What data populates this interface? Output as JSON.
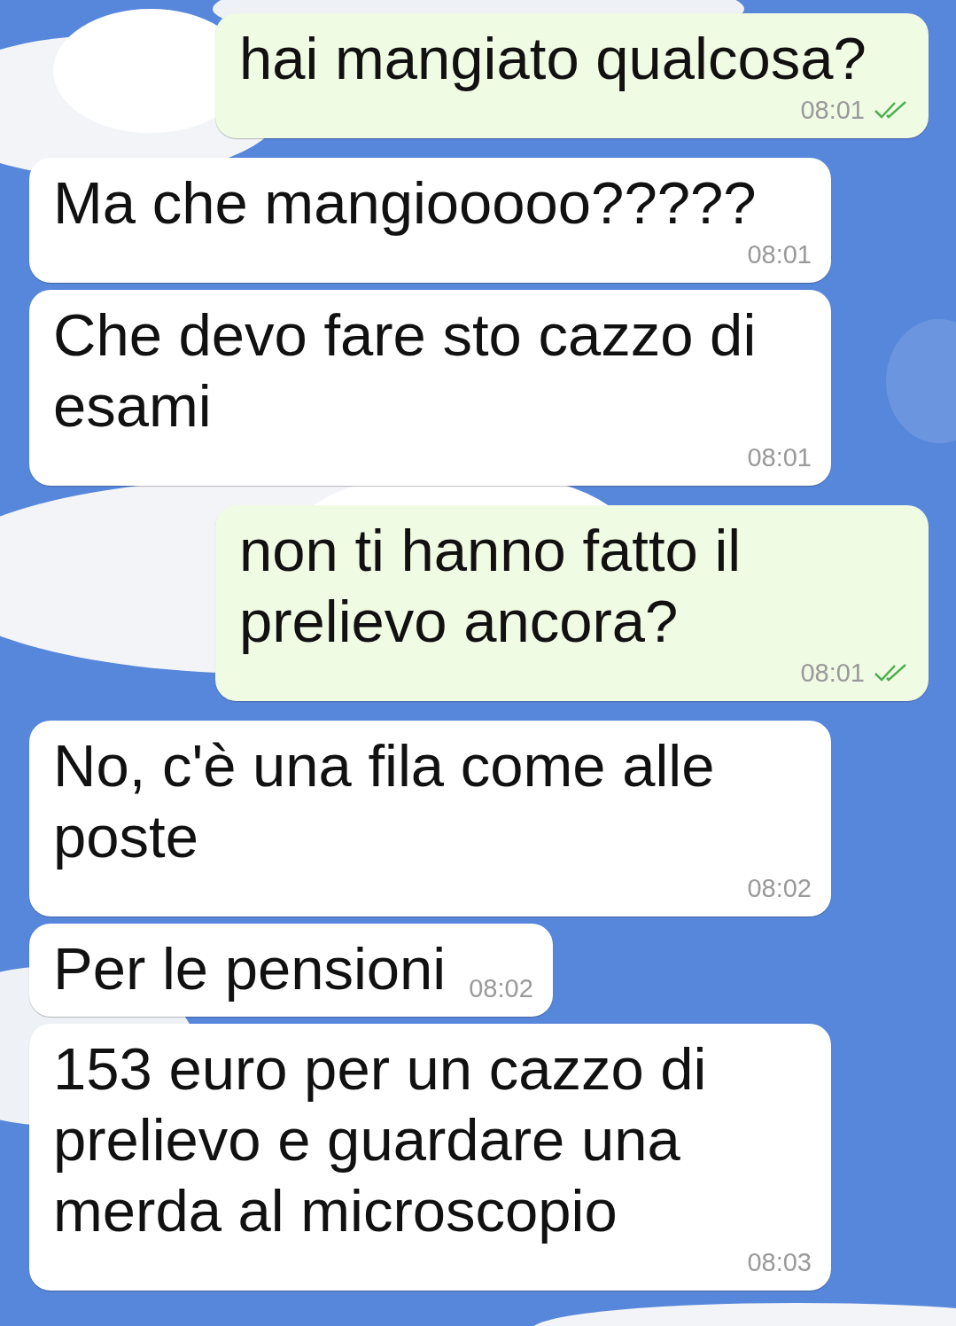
{
  "messages": [
    {
      "kind": "sent",
      "text": "hai mangiato qualcosa?",
      "time": "08:01",
      "read": true
    },
    {
      "kind": "received",
      "text": "Ma che mangiooooo?????",
      "time": "08:01"
    },
    {
      "kind": "received",
      "text": "Che devo fare sto cazzo di esami",
      "time": "08:01"
    },
    {
      "kind": "sent",
      "text": "non ti hanno fatto il prelievo ancora?",
      "time": "08:01",
      "read": true
    },
    {
      "kind": "received",
      "text": "No, c'è una fila come alle poste",
      "time": "08:02"
    },
    {
      "kind": "received",
      "text": "Per le pensioni",
      "time": "08:02"
    },
    {
      "kind": "received",
      "text": "153 euro per un cazzo di prelievo e guardare una merda al microscopio",
      "time": "08:03"
    }
  ]
}
